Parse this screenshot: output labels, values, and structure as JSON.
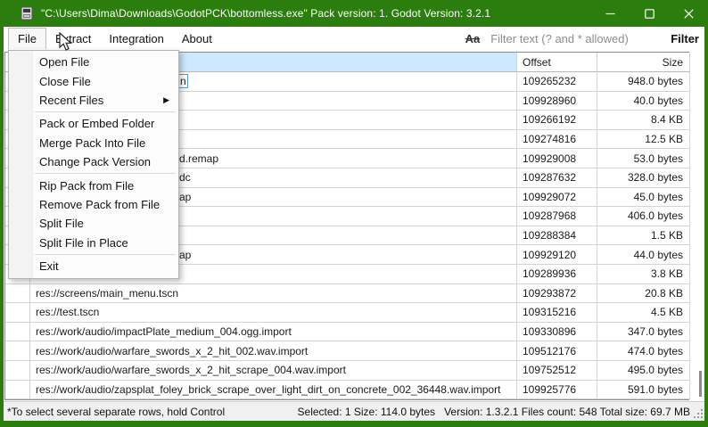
{
  "window": {
    "title": "\"C:\\Users\\Dima\\Downloads\\GodotPCK\\bottomless.exe\" Pack version: 1. Godot Version: 3.2.1"
  },
  "menubar": {
    "items": [
      "File",
      "Extract",
      "Integration",
      "About"
    ],
    "open_item": "File",
    "case_toggle": "Aa",
    "filter_placeholder": "Filter text (? and * allowed)",
    "filter_button": "Filter"
  },
  "file_menu": {
    "items": [
      {
        "label": "Open File"
      },
      {
        "label": "Close File"
      },
      {
        "label": "Recent Files",
        "submenu": true
      },
      {
        "separator": true
      },
      {
        "label": "Pack or Embed Folder"
      },
      {
        "label": "Merge Pack Into File"
      },
      {
        "label": "Change Pack Version"
      },
      {
        "separator": true
      },
      {
        "label": "Rip Pack from File"
      },
      {
        "label": "Remove Pack from File"
      },
      {
        "label": "Split File"
      },
      {
        "label": "Split File in Place"
      },
      {
        "separator": true
      },
      {
        "label": "Exit"
      }
    ]
  },
  "table": {
    "headers": {
      "path_label": "",
      "offset": "Offset",
      "size": "Size"
    },
    "rows": [
      {
        "path": "n",
        "covered": true,
        "selected": true,
        "offset": "109265232",
        "size": "948.0 bytes"
      },
      {
        "path": "",
        "covered": true,
        "offset": "109928960",
        "size": "40.0 bytes"
      },
      {
        "path": "",
        "covered": true,
        "offset": "109266192",
        "size": "8.4 KB"
      },
      {
        "path": "",
        "covered": true,
        "offset": "109274816",
        "size": "12.5 KB"
      },
      {
        "path": "d.remap",
        "covered": true,
        "offset": "109929008",
        "size": "53.0 bytes"
      },
      {
        "path": "dc",
        "covered": true,
        "offset": "109287632",
        "size": "328.0 bytes"
      },
      {
        "path": "ap",
        "covered": true,
        "offset": "109929072",
        "size": "45.0 bytes"
      },
      {
        "path": "",
        "covered": true,
        "offset": "109287968",
        "size": "406.0 bytes"
      },
      {
        "path": "",
        "covered": true,
        "offset": "109288384",
        "size": "1.5 KB"
      },
      {
        "path": "ap",
        "covered": true,
        "offset": "109929120",
        "size": "44.0 bytes"
      },
      {
        "path": "",
        "covered": true,
        "offset": "109289936",
        "size": "3.8 KB"
      },
      {
        "path": "res://screens/main_menu.tscn",
        "covered": false,
        "offset": "109293872",
        "size": "20.8 KB"
      },
      {
        "path": "res://test.tscn",
        "covered": false,
        "offset": "109315216",
        "size": "4.5 KB"
      },
      {
        "path": "res://work/audio/impactPlate_medium_004.ogg.import",
        "covered": false,
        "offset": "109330896",
        "size": "347.0 bytes"
      },
      {
        "path": "res://work/audio/warfare_swords_x_2_hit_002.wav.import",
        "covered": false,
        "offset": "109512176",
        "size": "474.0 bytes"
      },
      {
        "path": "res://work/audio/warfare_swords_x_2_hit_scrape_004.wav.import",
        "covered": false,
        "offset": "109752512",
        "size": "495.0 bytes"
      },
      {
        "path": "res://work/audio/zapsplat_foley_brick_scrape_over_light_dirt_on_concrete_002_36448.wav.import",
        "covered": false,
        "offset": "109925776",
        "size": "591.0 bytes"
      }
    ]
  },
  "statusbar": {
    "left": "*To select several separate rows, hold Control",
    "selected": "Selected: 1 Size: 114.0 bytes",
    "info": "Version: 1.3.2.1 Files count: 548 Total size: 69.7 MB"
  },
  "colors": {
    "titlebar_green": "#2b7d0d",
    "header_selected_blue": "#cde8ff"
  }
}
